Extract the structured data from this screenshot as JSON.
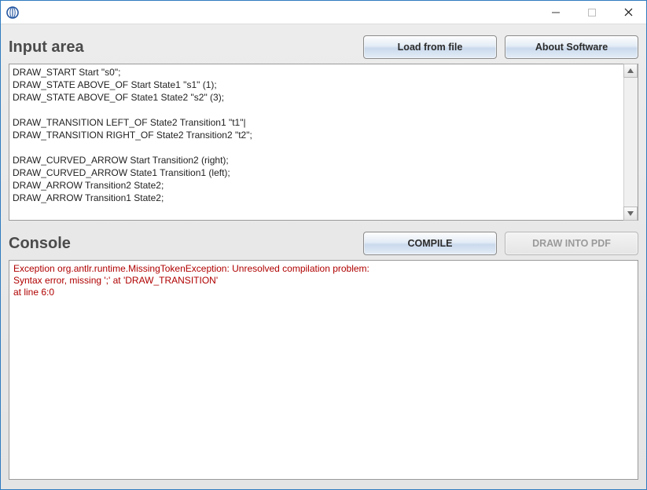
{
  "window": {
    "title": ""
  },
  "input_section": {
    "title": "Input area",
    "load_button": "Load from file",
    "about_button": "About Software",
    "content": "DRAW_START Start \"s0\";\nDRAW_STATE ABOVE_OF Start State1 \"s1\" (1);\nDRAW_STATE ABOVE_OF State1 State2 \"s2\" (3);\n\nDRAW_TRANSITION LEFT_OF State2 Transition1 \"t1\"|\nDRAW_TRANSITION RIGHT_OF State2 Transition2 \"t2\";\n\nDRAW_CURVED_ARROW Start Transition2 (right);\nDRAW_CURVED_ARROW State1 Transition1 (left);\nDRAW_ARROW Transition2 State2;\nDRAW_ARROW Transition1 State2;"
  },
  "console_section": {
    "title": "Console",
    "compile_button": "COMPILE",
    "draw_button": "DRAW INTO PDF",
    "draw_button_enabled": false,
    "output": "Exception org.antlr.runtime.MissingTokenException: Unresolved compilation problem:\nSyntax error, missing ';' at 'DRAW_TRANSITION'\nat line 6:0"
  }
}
